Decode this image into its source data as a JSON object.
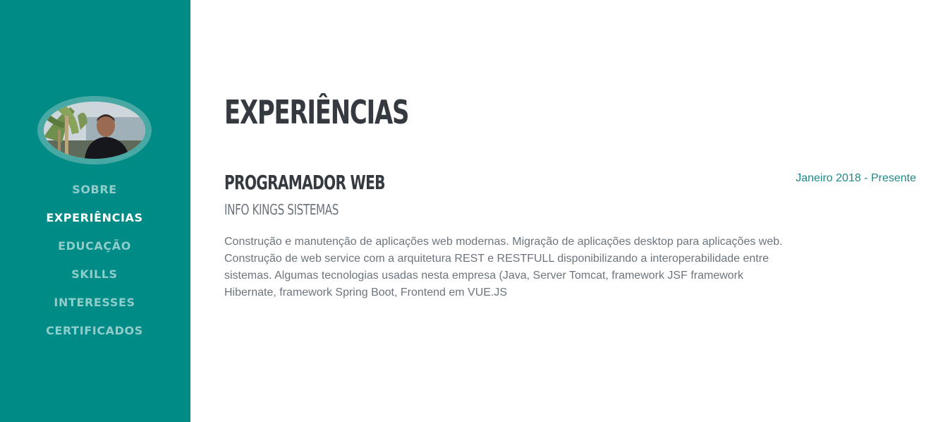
{
  "nav": {
    "items": [
      {
        "label": "SOBRE",
        "active": false
      },
      {
        "label": "EXPERIÊNCIAS",
        "active": true
      },
      {
        "label": "EDUCAÇÃO",
        "active": false
      },
      {
        "label": "SKILLS",
        "active": false
      },
      {
        "label": "INTERESSES",
        "active": false
      },
      {
        "label": "CERTIFICADOS",
        "active": false
      }
    ]
  },
  "section": {
    "title": "EXPERIÊNCIAS"
  },
  "experience": {
    "job_title": "PROGRAMADOR WEB",
    "company": "INFO KINGS SISTEMAS",
    "period": "Janeiro 2018 - Presente",
    "description": "Construção e manutenção de aplicações web modernas. Migração de aplicações desktop para aplicações web. Construção de web service com a arquitetura REST e RESTFULL disponibilizando a interoperabilidade entre sistemas. Algumas tecnologias usadas nesta empresa (Java, Server Tomcat, framework JSF framework Hibernate, framework Spring Boot, Frontend em VUE.JS"
  },
  "colors": {
    "sidebar": "#008b87",
    "nav_inactive": "#8fcdca",
    "nav_active": "#ffffff",
    "heading": "#343a40",
    "muted": "#6c757d",
    "accent": "#1e8a86"
  }
}
